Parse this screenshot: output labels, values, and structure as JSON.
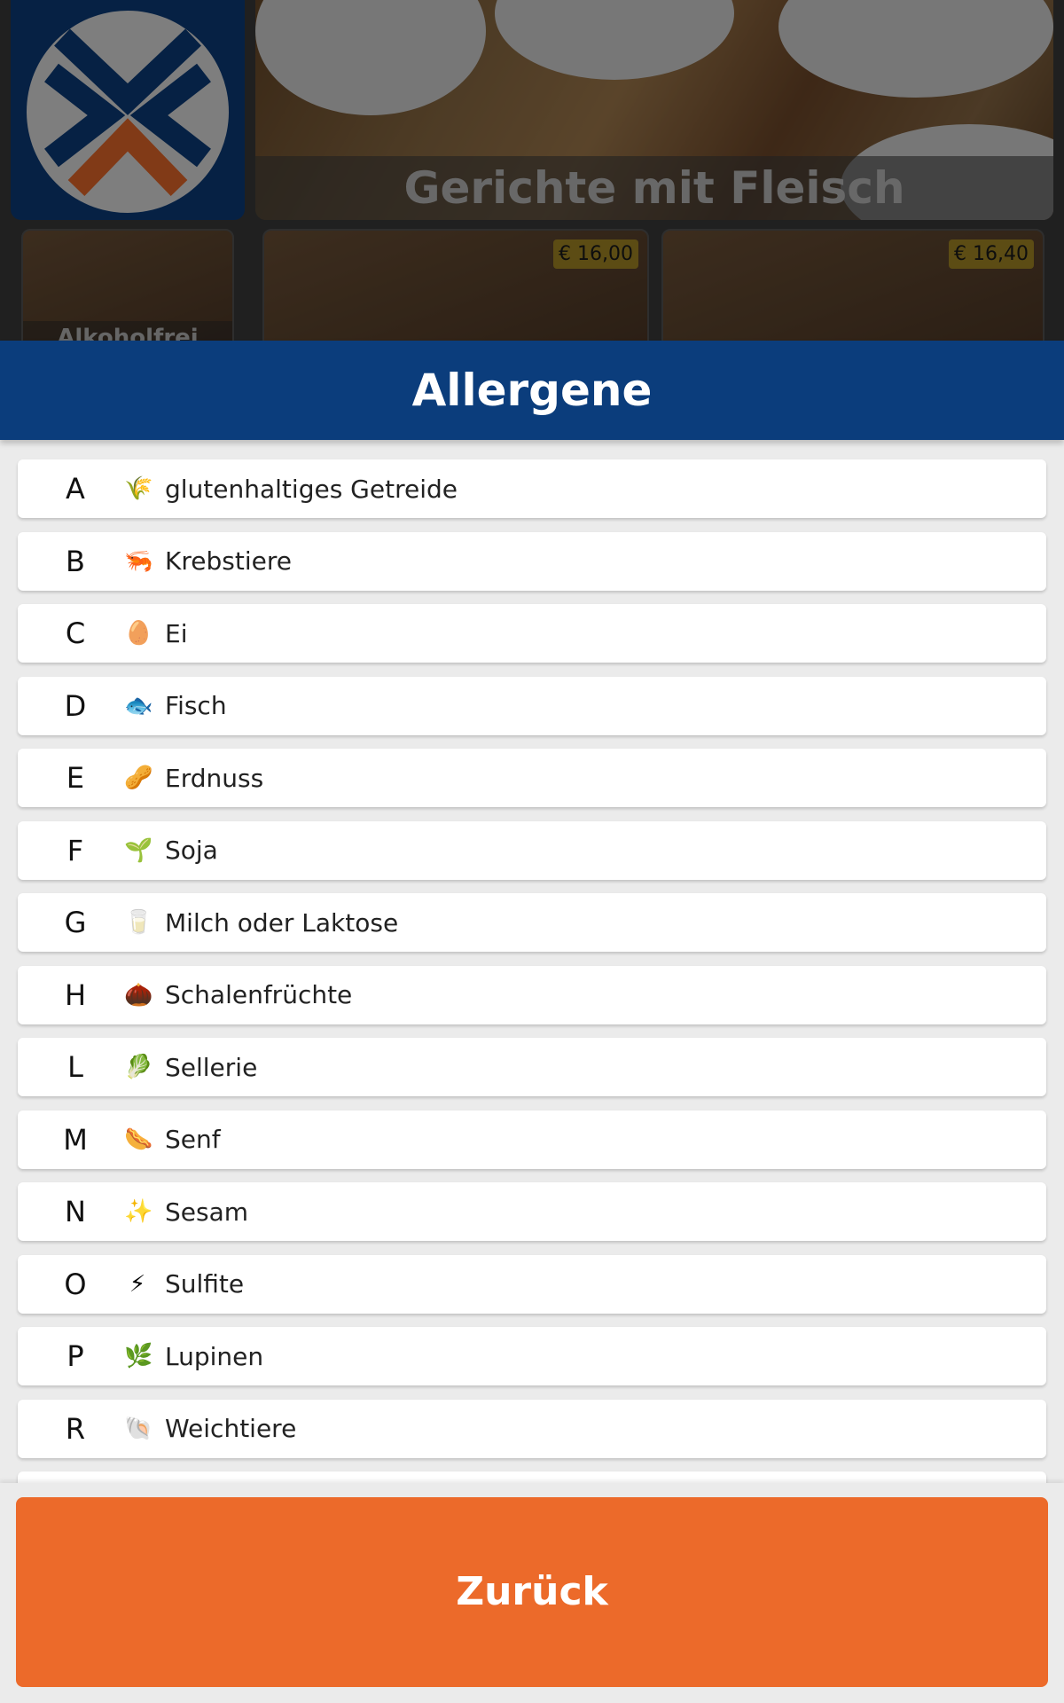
{
  "background": {
    "hero_title": "Gerichte mit Fleisch",
    "category_label": "Alkoholfrei",
    "prices": [
      "€ 16,00",
      "€ 16,40"
    ]
  },
  "modal": {
    "title": "Allergene",
    "allergens": [
      {
        "code": "A",
        "icon": "🌾",
        "label": "glutenhaltiges Getreide"
      },
      {
        "code": "B",
        "icon": "🦐",
        "label": "Krebstiere"
      },
      {
        "code": "C",
        "icon": "🥚",
        "label": "Ei"
      },
      {
        "code": "D",
        "icon": "🐟",
        "label": "Fisch"
      },
      {
        "code": "E",
        "icon": "🥜",
        "label": "Erdnuss"
      },
      {
        "code": "F",
        "icon": "🌱",
        "label": "Soja"
      },
      {
        "code": "G",
        "icon": "🥛",
        "label": "Milch oder Laktose"
      },
      {
        "code": "H",
        "icon": "🌰",
        "label": "Schalenfrüchte"
      },
      {
        "code": "L",
        "icon": "🥬",
        "label": "Sellerie"
      },
      {
        "code": "M",
        "icon": "🌭",
        "label": "Senf"
      },
      {
        "code": "N",
        "icon": "✨",
        "label": "Sesam"
      },
      {
        "code": "O",
        "icon": "⚡",
        "label": "Sulfite"
      },
      {
        "code": "P",
        "icon": "🌿",
        "label": "Lupinen"
      },
      {
        "code": "R",
        "icon": "🐚",
        "label": "Weichtiere"
      }
    ],
    "back_label": "Zurück"
  },
  "colors": {
    "brand_blue": "#0b3d7c",
    "accent_orange": "#ec6a2a"
  }
}
